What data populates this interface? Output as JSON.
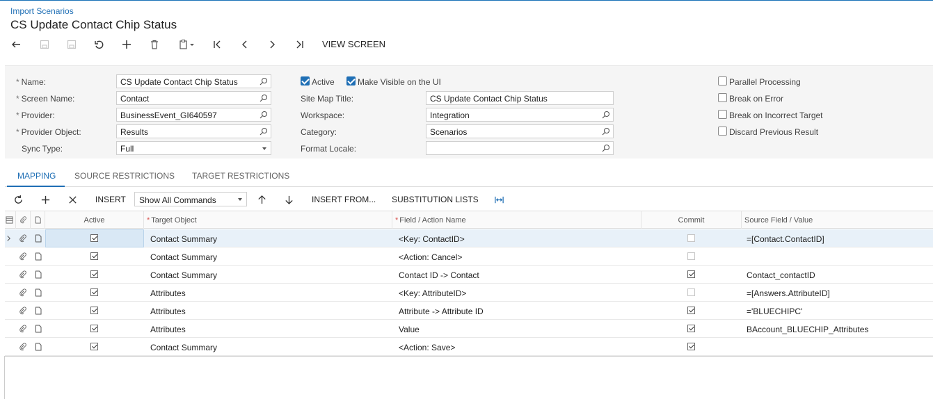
{
  "breadcrumb": "Import Scenarios",
  "page_title": "CS Update Contact Chip Status",
  "toolbar": {
    "view_screen": "VIEW SCREEN"
  },
  "form": {
    "name_label": "Name:",
    "name_value": "CS Update Contact Chip Status",
    "screen_name_label": "Screen Name:",
    "screen_name_value": "Contact",
    "provider_label": "Provider:",
    "provider_value": "BusinessEvent_GI640597",
    "provider_object_label": "Provider Object:",
    "provider_object_value": "Results",
    "sync_type_label": "Sync Type:",
    "sync_type_value": "Full",
    "active_label": "Active",
    "make_visible_label": "Make Visible on the UI",
    "site_map_title_label": "Site Map Title:",
    "site_map_title_value": "CS Update Contact Chip Status",
    "workspace_label": "Workspace:",
    "workspace_value": "Integration",
    "category_label": "Category:",
    "category_value": "Scenarios",
    "format_locale_label": "Format Locale:",
    "format_locale_value": "",
    "parallel_processing_label": "Parallel Processing",
    "break_on_error_label": "Break on Error",
    "break_on_incorrect_target_label": "Break on Incorrect Target",
    "discard_previous_result_label": "Discard Previous Result"
  },
  "tabs": [
    "MAPPING",
    "SOURCE RESTRICTIONS",
    "TARGET RESTRICTIONS"
  ],
  "grid_toolbar": {
    "insert": "INSERT",
    "command_filter": "Show All Commands",
    "insert_from": "INSERT FROM...",
    "substitution_lists": "SUBSTITUTION LISTS"
  },
  "grid": {
    "headers": {
      "active": "Active",
      "target_object": "Target Object",
      "field_action": "Field / Action Name",
      "commit": "Commit",
      "source_field": "Source Field / Value"
    },
    "rows": [
      {
        "active": true,
        "target": "Contact Summary",
        "field": "<Key: ContactID>",
        "commit": false,
        "commit_disabled": true,
        "source": "=[Contact.ContactID]"
      },
      {
        "active": true,
        "target": "Contact Summary",
        "field": "<Action: Cancel>",
        "commit": false,
        "commit_disabled": true,
        "source": ""
      },
      {
        "active": true,
        "target": "Contact Summary",
        "field": "Contact ID -> Contact",
        "commit": true,
        "commit_disabled": false,
        "source": "Contact_contactID"
      },
      {
        "active": true,
        "target": "Attributes",
        "field": "<Key: AttributeID>",
        "commit": false,
        "commit_disabled": true,
        "source": "=[Answers.AttributeID]"
      },
      {
        "active": true,
        "target": "Attributes",
        "field": "Attribute -> Attribute ID",
        "commit": true,
        "commit_disabled": false,
        "source": "='BLUECHIPC'"
      },
      {
        "active": true,
        "target": "Attributes",
        "field": "Value",
        "commit": true,
        "commit_disabled": false,
        "source": "BAccount_BLUECHIP_Attributes"
      },
      {
        "active": true,
        "target": "Contact Summary",
        "field": "<Action: Save>",
        "commit": true,
        "commit_disabled": false,
        "source": ""
      }
    ]
  },
  "colors": {
    "accent": "#1f6fb5",
    "selected_row": "#e8f1f9"
  }
}
